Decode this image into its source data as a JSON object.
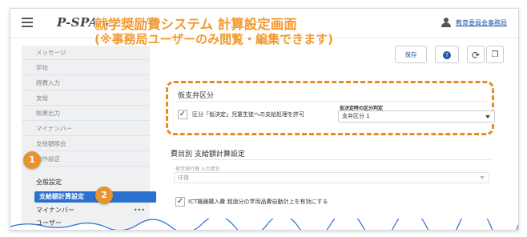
{
  "header": {
    "logo": "P-SPACE",
    "logo_sub": "就学奨励費",
    "help_badge": "?",
    "user_name": "教育委員会事務局"
  },
  "overlay": {
    "line1": "就学奨励費システム 計算設定画面",
    "line2": "(※事務局ユーザーのみ閲覧・編集できます)"
  },
  "toolbar": {
    "save_partial": "保存",
    "help": "?"
  },
  "sidebar": {
    "items": [
      {
        "label": "メッセージ"
      },
      {
        "label": "学校"
      },
      {
        "label": "経費入力"
      },
      {
        "label": "支給"
      },
      {
        "label": "帳票出力"
      },
      {
        "label": "マイナンバー"
      },
      {
        "label": "支給額照会"
      },
      {
        "label": "動作設定"
      }
    ],
    "subitems": [
      {
        "label": "全般設定"
      },
      {
        "label": "支給額計算設定"
      },
      {
        "label": "マイナンバー"
      },
      {
        "label": "ユーザー"
      }
    ],
    "more": "•••"
  },
  "provisional": {
    "title": "仮支弁区分",
    "checkbox_label": "区分「仮決定」児童生徒への支給処理を許可",
    "select_label": "仮決定時の区分判定",
    "select_value": "支弁区分 1"
  },
  "calc": {
    "title": "費目別 支給額計算設定",
    "input_label": "修学旅行費 入力単位",
    "input_value": "往復",
    "checkbox_label": "ICT機器購入費 超過分の学用品費自動計上を有効にする"
  },
  "badges": [
    "1",
    "2"
  ]
}
